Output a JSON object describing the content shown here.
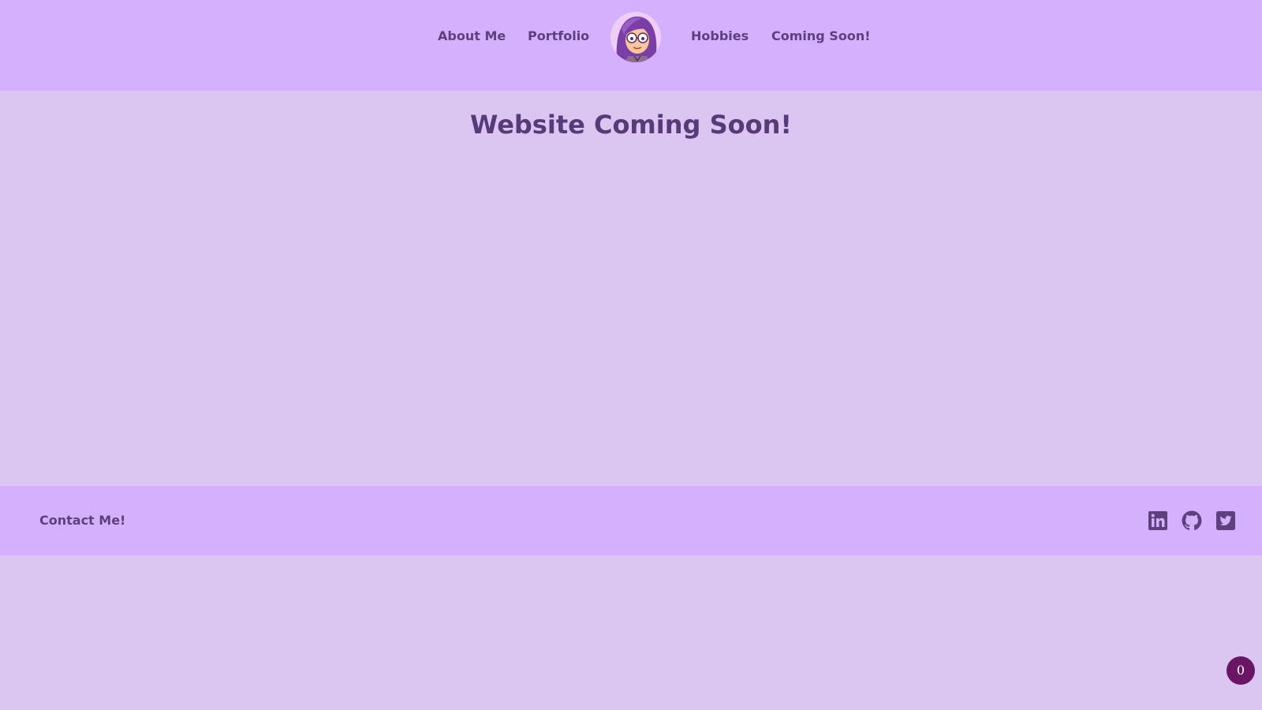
{
  "nav": {
    "links": [
      {
        "label": "About Me"
      },
      {
        "label": "Portfolio"
      },
      {
        "label": "Hobbies"
      },
      {
        "label": "Coming Soon!"
      }
    ],
    "avatar_icon": "avatar-illustration"
  },
  "main": {
    "title": "Website Coming Soon!"
  },
  "footer": {
    "contact_label": "Contact Me!",
    "social_icons": [
      "linkedin-icon",
      "github-icon",
      "twitter-icon"
    ]
  },
  "badge": {
    "count": "0"
  },
  "colors": {
    "header_bg": "#d4b0fd",
    "page_bg": "#dbc6f1",
    "text": "#5a3a7a",
    "badge_bg": "#6b1565"
  }
}
